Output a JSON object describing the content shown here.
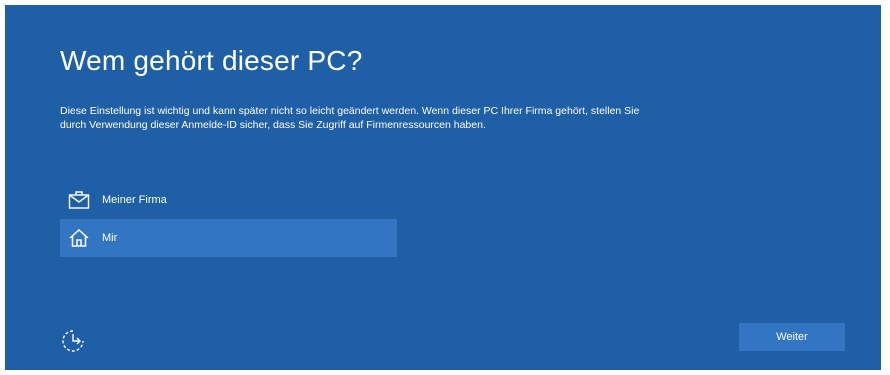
{
  "colors": {
    "background": "#1f5fa6",
    "selected_item": "#3275c2",
    "button": "#3275c2",
    "text": "#ffffff"
  },
  "page": {
    "title": "Wem gehört dieser PC?",
    "description": "Diese Einstellung ist wichtig und kann später nicht so leicht geändert werden. Wenn dieser PC Ihrer Firma gehört, stellen Sie durch Verwendung dieser Anmelde-ID sicher, dass Sie Zugriff auf Firmenressourcen haben."
  },
  "options": [
    {
      "label": "Meiner Firma",
      "icon": "briefcase-icon",
      "selected": false
    },
    {
      "label": "Mir",
      "icon": "home-icon",
      "selected": true
    }
  ],
  "footer": {
    "accessibility_icon": "ease-of-access-icon",
    "next_label": "Weiter"
  }
}
